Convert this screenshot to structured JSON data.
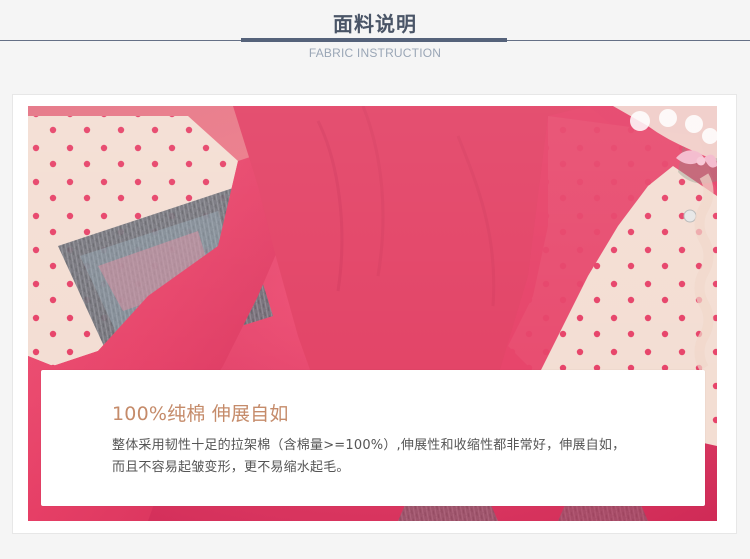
{
  "header": {
    "title": "面料说明",
    "subtitle": "FABRIC INSTRUCTION"
  },
  "card": {
    "heading": "100%纯棉 伸展自如",
    "body_lines": [
      "整体采用韧性十足的拉架棉（含棉量>=100%）,伸展性和收缩性都非常好，伸展自如，",
      "而且不容易起皱变形，更不易缩水起毛。"
    ]
  },
  "colors": {
    "header_text": "#4a5567",
    "header_rule": "#55627a",
    "subtitle_text": "#9aa6b6",
    "heading_accent": "#c58b6a",
    "fabric_red": "#e63f66",
    "fabric_cream": "#f3ddd2"
  }
}
